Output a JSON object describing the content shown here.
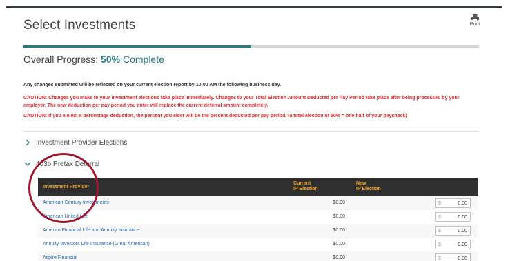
{
  "page": {
    "title": "Select Investments",
    "print_label": "Print"
  },
  "progress": {
    "label": "Overall Progress:",
    "percent_text": "50%",
    "complete_text": "Complete",
    "fraction": 0.5
  },
  "notices": {
    "info": "Any changes submitted will be reflected on your current election report by 10:00 AM the following business day.",
    "caution_1": "CAUTION: Changes you make to your investment elections take place immediately. Changes to your Total Election Amount Deducted per Pay Period take place after being processed by your employer. The new deduction per pay period you enter will replace the current deferral amount completely.",
    "caution_2": "CAUTION: If you a elect a percentage deduction, the percent you elect will be the percent deducted per pay period. (a total election of 50% = one half of your paycheck)"
  },
  "sections": {
    "provider_elections": "Investment Provider Elections",
    "pretax_deferral": "403b Pretax Deferral"
  },
  "table": {
    "headers": {
      "provider": "Investment Provider",
      "current_line1": "Current",
      "current_line2": "IP Election",
      "new_line1": "New",
      "new_line2": "IP Election"
    },
    "currency_symbol": "$",
    "rows": [
      {
        "provider": "American Century Investments",
        "current": "$0.00",
        "new": "0.00"
      },
      {
        "provider": "American United Life",
        "current": "$0.00",
        "new": "0.00"
      },
      {
        "provider": "Americo Financial Life and Annuity Insurance",
        "current": "$0.00",
        "new": "0.00"
      },
      {
        "provider": "Annuity Investors Life Insurance (Great American)",
        "current": "$0.00",
        "new": "0.00"
      },
      {
        "provider": "Aspire Financial",
        "current": "$0.00",
        "new": "0.00"
      }
    ]
  },
  "colors": {
    "accent": "#2c7a89",
    "caution": "#e3262b",
    "header_bg": "#2f2f2f",
    "header_text": "#f5a623",
    "link": "#2a6ab5",
    "highlight_circle": "#a0182e"
  },
  "icons": {
    "print": "printer-icon",
    "collapsed": "chevron-right-icon",
    "expanded": "chevron-down-icon"
  }
}
